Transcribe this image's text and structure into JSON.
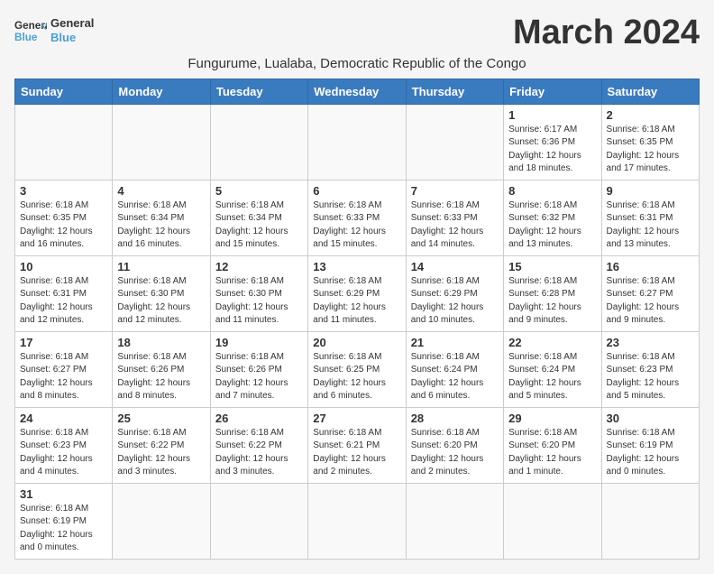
{
  "header": {
    "logo_general": "General",
    "logo_blue": "Blue",
    "month_title": "March 2024",
    "subtitle": "Fungurume, Lualaba, Democratic Republic of the Congo"
  },
  "weekdays": [
    "Sunday",
    "Monday",
    "Tuesday",
    "Wednesday",
    "Thursday",
    "Friday",
    "Saturday"
  ],
  "weeks": [
    [
      {
        "day": "",
        "info": ""
      },
      {
        "day": "",
        "info": ""
      },
      {
        "day": "",
        "info": ""
      },
      {
        "day": "",
        "info": ""
      },
      {
        "day": "",
        "info": ""
      },
      {
        "day": "1",
        "info": "Sunrise: 6:17 AM\nSunset: 6:36 PM\nDaylight: 12 hours and 18 minutes."
      },
      {
        "day": "2",
        "info": "Sunrise: 6:18 AM\nSunset: 6:35 PM\nDaylight: 12 hours and 17 minutes."
      }
    ],
    [
      {
        "day": "3",
        "info": "Sunrise: 6:18 AM\nSunset: 6:35 PM\nDaylight: 12 hours and 16 minutes."
      },
      {
        "day": "4",
        "info": "Sunrise: 6:18 AM\nSunset: 6:34 PM\nDaylight: 12 hours and 16 minutes."
      },
      {
        "day": "5",
        "info": "Sunrise: 6:18 AM\nSunset: 6:34 PM\nDaylight: 12 hours and 15 minutes."
      },
      {
        "day": "6",
        "info": "Sunrise: 6:18 AM\nSunset: 6:33 PM\nDaylight: 12 hours and 15 minutes."
      },
      {
        "day": "7",
        "info": "Sunrise: 6:18 AM\nSunset: 6:33 PM\nDaylight: 12 hours and 14 minutes."
      },
      {
        "day": "8",
        "info": "Sunrise: 6:18 AM\nSunset: 6:32 PM\nDaylight: 12 hours and 13 minutes."
      },
      {
        "day": "9",
        "info": "Sunrise: 6:18 AM\nSunset: 6:31 PM\nDaylight: 12 hours and 13 minutes."
      }
    ],
    [
      {
        "day": "10",
        "info": "Sunrise: 6:18 AM\nSunset: 6:31 PM\nDaylight: 12 hours and 12 minutes."
      },
      {
        "day": "11",
        "info": "Sunrise: 6:18 AM\nSunset: 6:30 PM\nDaylight: 12 hours and 12 minutes."
      },
      {
        "day": "12",
        "info": "Sunrise: 6:18 AM\nSunset: 6:30 PM\nDaylight: 12 hours and 11 minutes."
      },
      {
        "day": "13",
        "info": "Sunrise: 6:18 AM\nSunset: 6:29 PM\nDaylight: 12 hours and 11 minutes."
      },
      {
        "day": "14",
        "info": "Sunrise: 6:18 AM\nSunset: 6:29 PM\nDaylight: 12 hours and 10 minutes."
      },
      {
        "day": "15",
        "info": "Sunrise: 6:18 AM\nSunset: 6:28 PM\nDaylight: 12 hours and 9 minutes."
      },
      {
        "day": "16",
        "info": "Sunrise: 6:18 AM\nSunset: 6:27 PM\nDaylight: 12 hours and 9 minutes."
      }
    ],
    [
      {
        "day": "17",
        "info": "Sunrise: 6:18 AM\nSunset: 6:27 PM\nDaylight: 12 hours and 8 minutes."
      },
      {
        "day": "18",
        "info": "Sunrise: 6:18 AM\nSunset: 6:26 PM\nDaylight: 12 hours and 8 minutes."
      },
      {
        "day": "19",
        "info": "Sunrise: 6:18 AM\nSunset: 6:26 PM\nDaylight: 12 hours and 7 minutes."
      },
      {
        "day": "20",
        "info": "Sunrise: 6:18 AM\nSunset: 6:25 PM\nDaylight: 12 hours and 6 minutes."
      },
      {
        "day": "21",
        "info": "Sunrise: 6:18 AM\nSunset: 6:24 PM\nDaylight: 12 hours and 6 minutes."
      },
      {
        "day": "22",
        "info": "Sunrise: 6:18 AM\nSunset: 6:24 PM\nDaylight: 12 hours and 5 minutes."
      },
      {
        "day": "23",
        "info": "Sunrise: 6:18 AM\nSunset: 6:23 PM\nDaylight: 12 hours and 5 minutes."
      }
    ],
    [
      {
        "day": "24",
        "info": "Sunrise: 6:18 AM\nSunset: 6:23 PM\nDaylight: 12 hours and 4 minutes."
      },
      {
        "day": "25",
        "info": "Sunrise: 6:18 AM\nSunset: 6:22 PM\nDaylight: 12 hours and 3 minutes."
      },
      {
        "day": "26",
        "info": "Sunrise: 6:18 AM\nSunset: 6:22 PM\nDaylight: 12 hours and 3 minutes."
      },
      {
        "day": "27",
        "info": "Sunrise: 6:18 AM\nSunset: 6:21 PM\nDaylight: 12 hours and 2 minutes."
      },
      {
        "day": "28",
        "info": "Sunrise: 6:18 AM\nSunset: 6:20 PM\nDaylight: 12 hours and 2 minutes."
      },
      {
        "day": "29",
        "info": "Sunrise: 6:18 AM\nSunset: 6:20 PM\nDaylight: 12 hours and 1 minute."
      },
      {
        "day": "30",
        "info": "Sunrise: 6:18 AM\nSunset: 6:19 PM\nDaylight: 12 hours and 0 minutes."
      }
    ],
    [
      {
        "day": "31",
        "info": "Sunrise: 6:18 AM\nSunset: 6:19 PM\nDaylight: 12 hours and 0 minutes."
      },
      {
        "day": "",
        "info": ""
      },
      {
        "day": "",
        "info": ""
      },
      {
        "day": "",
        "info": ""
      },
      {
        "day": "",
        "info": ""
      },
      {
        "day": "",
        "info": ""
      },
      {
        "day": "",
        "info": ""
      }
    ]
  ]
}
